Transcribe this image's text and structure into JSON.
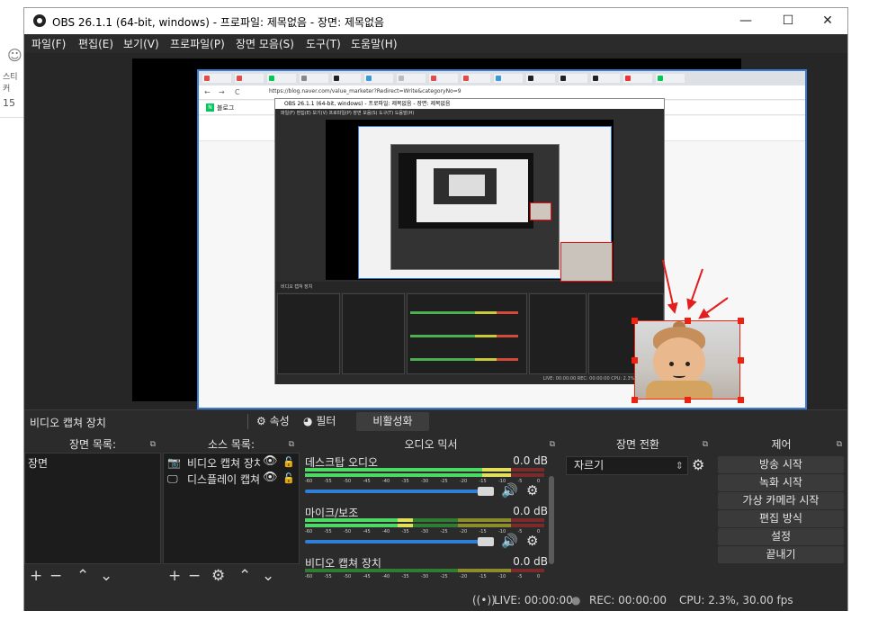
{
  "background": {
    "side_label": "스티커",
    "side_number": "15"
  },
  "window": {
    "title": "OBS 26.1.1 (64-bit, windows) - 프로파일: 제목없음 - 장면: 제목없음",
    "minimize": "—",
    "maximize": "☐",
    "close": "✕"
  },
  "menu": [
    "파일(F)",
    "편집(E)",
    "보기(V)",
    "프로파일(P)",
    "장면 모음(S)",
    "도구(T)",
    "도움말(H)"
  ],
  "preview": {
    "url": "https://blog.naver.com/value_marketer?Redirect=Write&categoryNo=9",
    "blog_label": "블로그",
    "nested_title": "OBS 26.1.1 (64-bit, windows) - 프로파일: 제목없음 - 장면: 제목없음",
    "nested_menu": "파일(F)   편집(E)   보기(V)   프로파일(P)   장면 모음(S)   도구(T)   도움말(H)",
    "nested_source": "비디오 캡쳐 장치",
    "nested_status": "LIVE: 00:00:00   REC: 00:00:00   CPU: 2.3%, 30.00 fps"
  },
  "source_toolbar": {
    "source_name": "비디오 캡쳐 장치",
    "properties": "속성",
    "filters": "필터",
    "deactivate": "비활성화"
  },
  "docks": {
    "scenes": {
      "title": "장면 목록:",
      "items": [
        "장면"
      ]
    },
    "sources": {
      "title": "소스 목록:",
      "items": [
        {
          "icon": "camera-icon",
          "label": "비디오 캡쳐 장치"
        },
        {
          "icon": "monitor-icon",
          "label": "디스플레이 캡쳐"
        }
      ]
    },
    "mixer": {
      "title": "오디오 믹서",
      "ticks": [
        "-60",
        "-55",
        "-50",
        "-45",
        "-40",
        "-35",
        "-30",
        "-25",
        "-20",
        "-15",
        "-10",
        "-5",
        "0"
      ],
      "channels": [
        {
          "name": "데스크탑 오디오",
          "db": "0.0 dB",
          "level": 0.86
        },
        {
          "name": "마이크/보조",
          "db": "0.0 dB",
          "level": 0.45
        },
        {
          "name": "비디오 캡쳐 장치",
          "db": "0.0 dB",
          "level": 0.0
        }
      ]
    },
    "transitions": {
      "title": "장면 전환",
      "selected": "자르기"
    },
    "controls": {
      "title": "제어",
      "buttons": [
        "방송 시작",
        "녹화 시작",
        "가상 카메라 시작",
        "편집 방식",
        "설정",
        "끝내기"
      ]
    }
  },
  "status": {
    "live": "LIVE: 00:00:00",
    "rec": "REC: 00:00:00",
    "cpu": "CPU: 2.3%, 30.00 fps"
  },
  "colors": {
    "selection_red": "#e21e1e",
    "selection_blue": "#3a7bd5",
    "accent_blue": "#2f7fd8"
  }
}
